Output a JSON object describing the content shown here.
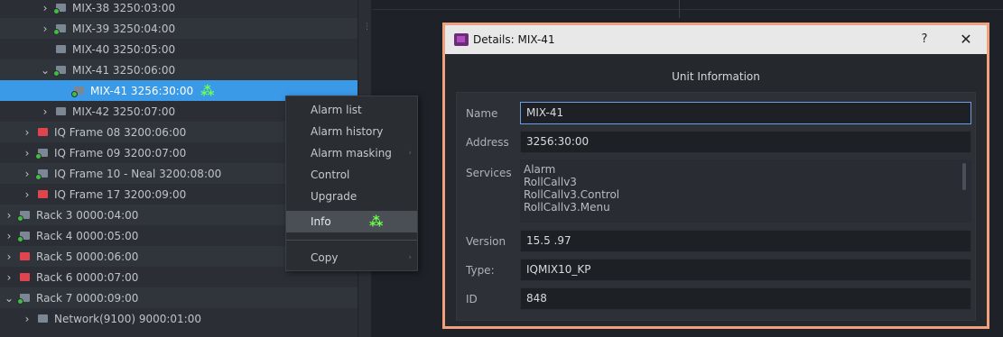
{
  "tree": {
    "rows": [
      {
        "label": "MIX-38 3250:03:00",
        "expander": "›",
        "indent": 2,
        "icon": "gray",
        "status": "green",
        "alt": false,
        "selected": false
      },
      {
        "label": "MIX-39 3250:04:00",
        "expander": "›",
        "indent": 2,
        "icon": "gray",
        "status": "green",
        "alt": true,
        "selected": false
      },
      {
        "label": "MIX-40 3250:05:00",
        "expander": "",
        "indent": 2,
        "icon": "gray",
        "status": "none",
        "alt": false,
        "selected": false
      },
      {
        "label": "MIX-41 3250:06:00",
        "expander": "⌄",
        "indent": 2,
        "icon": "gray",
        "status": "green",
        "alt": true,
        "selected": false
      },
      {
        "label": "MIX-41 3256:30:00",
        "expander": "",
        "indent": 3,
        "icon": "gray",
        "status": "green",
        "alt": false,
        "selected": true
      },
      {
        "label": "MIX-42 3250:07:00",
        "expander": "›",
        "indent": 2,
        "icon": "gray",
        "status": "none",
        "alt": false,
        "selected": false
      },
      {
        "label": "IQ Frame 08 3200:06:00",
        "expander": "›",
        "indent": 1,
        "icon": "red",
        "status": "none",
        "alt": true,
        "selected": false
      },
      {
        "label": "IQ Frame 09 3200:07:00",
        "expander": "›",
        "indent": 1,
        "icon": "gray",
        "status": "green",
        "alt": false,
        "selected": false
      },
      {
        "label": "IQ Frame 10 - Neal 3200:08:00",
        "expander": "›",
        "indent": 1,
        "icon": "gray",
        "status": "green",
        "alt": true,
        "selected": false
      },
      {
        "label": "IQ Frame 17 3200:09:00",
        "expander": "›",
        "indent": 1,
        "icon": "red",
        "status": "none",
        "alt": false,
        "selected": false
      },
      {
        "label": "Rack 3 0000:04:00",
        "expander": "›",
        "indent": 0,
        "icon": "gray",
        "status": "green",
        "alt": true,
        "selected": false
      },
      {
        "label": "Rack 4 0000:05:00",
        "expander": "›",
        "indent": 0,
        "icon": "gray",
        "status": "green",
        "alt": false,
        "selected": false
      },
      {
        "label": "Rack 5 0000:06:00",
        "expander": "›",
        "indent": 0,
        "icon": "red",
        "status": "none",
        "alt": true,
        "selected": false
      },
      {
        "label": "Rack 6 0000:07:00",
        "expander": "›",
        "indent": 0,
        "icon": "red",
        "status": "none",
        "alt": false,
        "selected": false
      },
      {
        "label": "Rack 7 0000:09:00",
        "expander": "⌄",
        "indent": 0,
        "icon": "gray",
        "status": "green",
        "alt": true,
        "selected": false
      },
      {
        "label": "Network(9100) 9000:01:00",
        "expander": "›",
        "indent": 1,
        "icon": "gray",
        "status": "none",
        "alt": false,
        "selected": false
      }
    ]
  },
  "context_menu": {
    "items": [
      {
        "label": "Alarm list",
        "submenu": false,
        "highlighted": false
      },
      {
        "label": "Alarm history",
        "submenu": false,
        "highlighted": false
      },
      {
        "label": "Alarm masking",
        "submenu": true,
        "highlighted": false
      },
      {
        "label": "Control",
        "submenu": false,
        "highlighted": false
      },
      {
        "label": "Upgrade",
        "submenu": false,
        "highlighted": false
      },
      {
        "label": "Info",
        "submenu": false,
        "highlighted": true
      },
      {
        "label": "Copy",
        "submenu": true,
        "highlighted": false
      }
    ]
  },
  "dialog": {
    "title": "Details: MIX-41",
    "help_label": "?",
    "close_label": "✕",
    "section_title": "Unit Information",
    "name_label": "Name",
    "name_value": "MIX-41",
    "address_label": "Address",
    "address_value": "3256:30:00",
    "services_label": "Services",
    "services": [
      "Alarm",
      "RollCallv3",
      "RollCallv3.Control",
      "RollCallv3.Menu"
    ],
    "version_label": "Version",
    "version_value": "15.5 .97",
    "type_label": "Type:",
    "type_value": "IQMIX10_KP",
    "id_label": "ID",
    "id_value": "848"
  },
  "colors": {
    "selection": "#3a9ae8",
    "dialog_border": "#f0a07a",
    "status_green": "#3fbf3f",
    "status_red": "#e0444c",
    "sparkle": "#6cff4c"
  }
}
